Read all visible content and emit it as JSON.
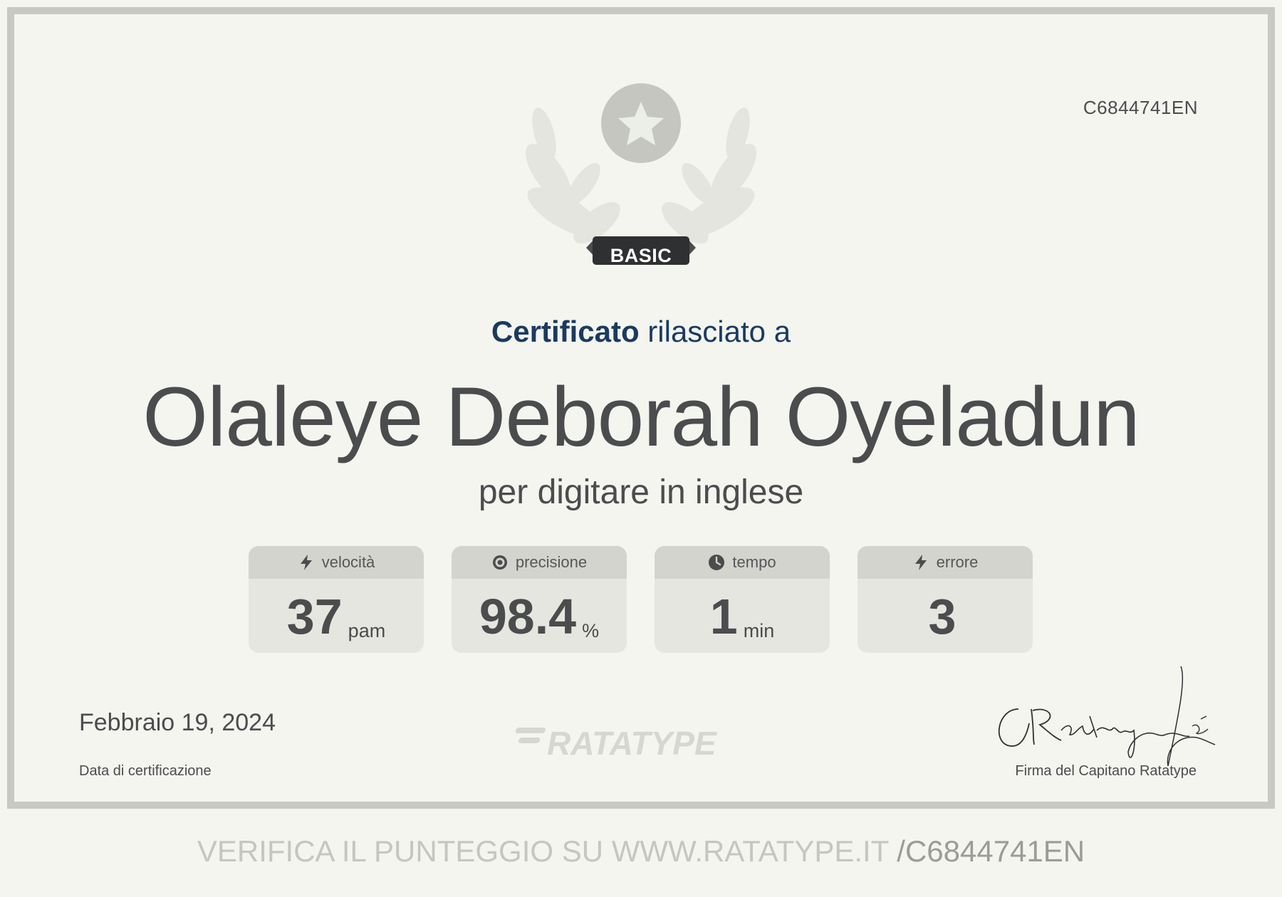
{
  "certificate_code": "C6844741EN",
  "badge": {
    "label": "BASIC",
    "icon": "star-badge-icon"
  },
  "title": {
    "bold": "Certificato",
    "rest": "rilasciato a"
  },
  "recipient_name": "Olaleye Deborah Oyeladun",
  "subject": "per digitare in inglese",
  "stats": [
    {
      "label": "velocità",
      "value": "37",
      "unit": "pam",
      "icon": "lightning-icon"
    },
    {
      "label": "precisione",
      "value": "98.4",
      "unit": "%",
      "icon": "target-icon"
    },
    {
      "label": "tempo",
      "value": "1",
      "unit": "min",
      "icon": "clock-icon"
    },
    {
      "label": "errore",
      "value": "3",
      "unit": "",
      "icon": "lightning-icon"
    }
  ],
  "date": {
    "value": "Febbraio 19, 2024",
    "label": "Data di certificazione"
  },
  "logo_text": "RATATYPE",
  "signature": {
    "label": "Firma del Capitano Ratatype"
  },
  "verify": {
    "prefix": "VERIFICA IL PUNTEGGIO SU WWW.RATATYPE.IT",
    "code": "/C6844741EN"
  },
  "colors": {
    "background": "#f4f5ef",
    "frame": "#c8c9c2",
    "title_blue": "#1b3a61",
    "text_dark": "#4a4c4e"
  }
}
